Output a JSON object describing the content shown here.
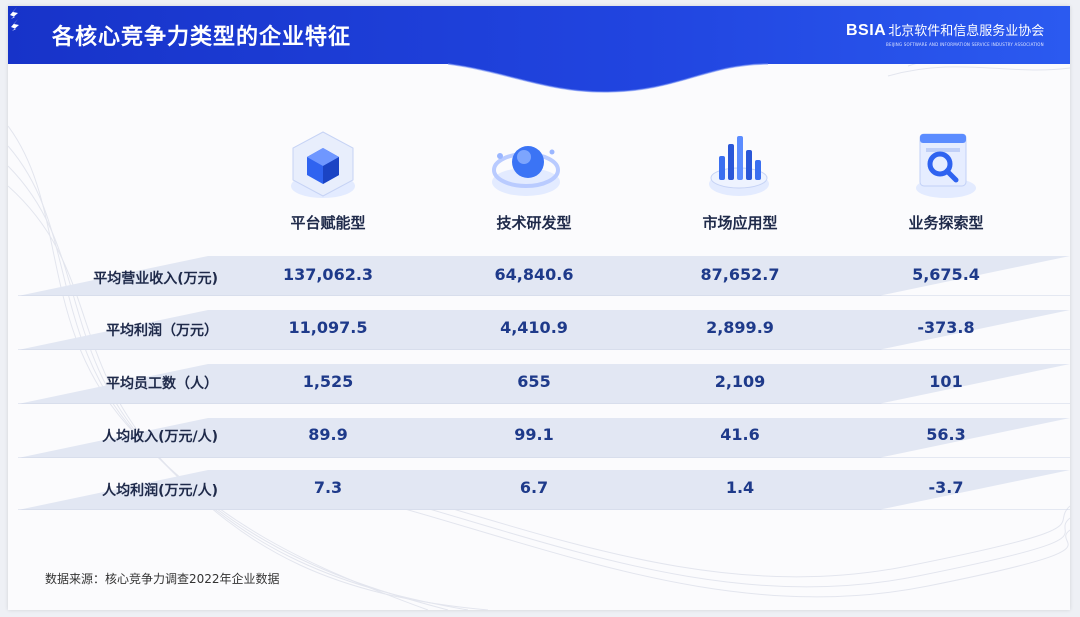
{
  "header": {
    "title": "各核心竞争力类型的企业特征",
    "logo_mark": "BSIA",
    "logo_cn": "北京软件和信息服务业协会",
    "logo_en": "BEIJING SOFTWARE AND INFORMATION SERVICE INDUSTRY ASSOCIATION"
  },
  "columns": [
    {
      "label": "平台赋能型",
      "icon": "platform-cube-icon"
    },
    {
      "label": "技术研发型",
      "icon": "tech-orb-icon"
    },
    {
      "label": "市场应用型",
      "icon": "market-bars-icon"
    },
    {
      "label": "业务探索型",
      "icon": "explore-search-icon"
    }
  ],
  "rows": [
    {
      "label": "平均营业收入(万元)",
      "values": [
        "137,062.3",
        "64,840.6",
        "87,652.7",
        "5,675.4"
      ]
    },
    {
      "label": "平均利润（万元）",
      "values": [
        "11,097.5",
        "4,410.9",
        "2,899.9",
        "-373.8"
      ]
    },
    {
      "label": "平均员工数（人）",
      "values": [
        "1,525",
        "655",
        "2,109",
        "101"
      ]
    },
    {
      "label": "人均收入(万元/人)",
      "values": [
        "89.9",
        "99.1",
        "41.6",
        "56.3"
      ]
    },
    {
      "label": "人均利润(万元/人)",
      "values": [
        "7.3",
        "6.7",
        "1.4",
        "-3.7"
      ]
    }
  ],
  "source": "数据来源：核心竞争力调查2022年企业数据",
  "colors": {
    "header_blue": "#1f3fd1",
    "value_blue": "#1e3a8a",
    "label_dark": "#1f2a4a"
  }
}
